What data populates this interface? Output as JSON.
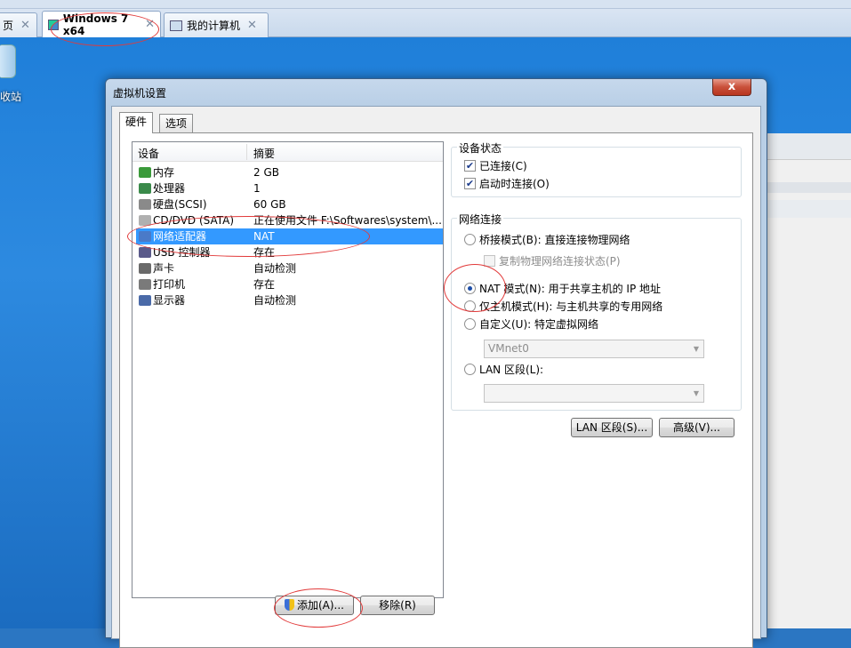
{
  "browser_tabs": [
    {
      "label": "页",
      "active": false
    },
    {
      "label": "Windows 7 x64",
      "active": true
    },
    {
      "label": "我的计算机",
      "active": false
    }
  ],
  "desktop": {
    "recycle_label": "收站"
  },
  "dialog": {
    "title": "虚拟机设置",
    "close_glyph": "x",
    "tabs": [
      "硬件",
      "选项"
    ],
    "device_list": {
      "headers": {
        "device": "设备",
        "summary": "摘要"
      },
      "rows": [
        {
          "name": "内存",
          "value": "2 GB",
          "icon": "memory-icon",
          "color": "#3a9a3a"
        },
        {
          "name": "处理器",
          "value": "1",
          "icon": "processor-icon",
          "color": "#3a8a4a"
        },
        {
          "name": "硬盘(SCSI)",
          "value": "60 GB",
          "icon": "hard-disk-icon",
          "color": "#8a8a8a"
        },
        {
          "name": "CD/DVD (SATA)",
          "value": "正在使用文件 F:\\Softwares\\system\\...",
          "icon": "cd-dvd-icon",
          "color": "#b0b0b0"
        },
        {
          "name": "网络适配器",
          "value": "NAT",
          "icon": "network-adapter-icon",
          "color": "#4a7ac8",
          "selected": true
        },
        {
          "name": "USB 控制器",
          "value": "存在",
          "icon": "usb-icon",
          "color": "#5a5a8a"
        },
        {
          "name": "声卡",
          "value": "自动检测",
          "icon": "sound-card-icon",
          "color": "#6a6a6a"
        },
        {
          "name": "打印机",
          "value": "存在",
          "icon": "printer-icon",
          "color": "#7a7a7a"
        },
        {
          "name": "显示器",
          "value": "自动检测",
          "icon": "display-icon",
          "color": "#4a6aa8"
        }
      ]
    },
    "buttons": {
      "add": "添加(A)...",
      "remove": "移除(R)",
      "lan_segments": "LAN 区段(S)...",
      "advanced": "高级(V)..."
    },
    "device_status": {
      "legend": "设备状态",
      "connected": {
        "label": "已连接(C)",
        "checked": true
      },
      "connect_at_power_on": {
        "label": "启动时连接(O)",
        "checked": true
      }
    },
    "network_connection": {
      "legend": "网络连接",
      "bridged": "桥接模式(B): 直接连接物理网络",
      "replicate": "复制物理网络连接状态(P)",
      "nat": "NAT 模式(N): 用于共享主机的 IP 地址",
      "host_only": "仅主机模式(H): 与主机共享的专用网络",
      "custom": "自定义(U): 特定虚拟网络",
      "custom_value": "VMnet0",
      "lan_segment": "LAN 区段(L):",
      "lan_segment_value": "",
      "selected": "nat"
    }
  }
}
